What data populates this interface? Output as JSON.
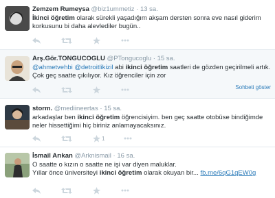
{
  "tweets": [
    {
      "name": "Zemzem Rumeysa",
      "handle": "@biz1ummetiz",
      "time": "13 sa.",
      "text_html": "<b>İkinci öğretim</b> olarak sürekli yaşadığım  akşam dersten sonra eve nasıl giderim korkusunu bi daha alevlediler bugün.."
    },
    {
      "name": "Arş.Gör.TONGUCOGLU",
      "handle": "@PTongucoglu",
      "time": "15 sa.",
      "text_html": "<span class=\"link\">@ahmetvehbi</span> <span class=\"link\">@detroitlikizil</span> abi <b>ikinci öğretim</b> saatleri de gözden geçirilmeli artık. Çok geç saatte çıkılıyor. Kız öğrenciler için zor",
      "show_conversation": "Sohbeti göster"
    },
    {
      "name": "storm.",
      "handle": "@mediineertas",
      "time": "15 sa.",
      "text_html": "arkadaşlar ben <b>ikinci öğretim</b> öğrencisiyim. ben geç saatte otobüse bindiğimde neler hissettiğimi hiç biriniz anlamayacaksınız.",
      "favorites": "1"
    },
    {
      "name": "İsmail Arıkan",
      "handle": "@Arknismail",
      "time": "16 sa.",
      "text_html": "O saatte o kızın o saatte ne işi var diyen maluklar.<br>Yıllar önce üniversiteyi <b>ikinci öğretim</b> olarak okuyan bir... <span class=\"link\" style=\"text-decoration:underline\">fb.me/6qG1qEW0g</span>"
    }
  ],
  "icons": {
    "reply": "reply-icon",
    "retweet": "retweet-icon",
    "favorite": "star-icon",
    "more": "more-icon"
  },
  "colors": {
    "link": "#2b7bb9",
    "muted": "#8899a6",
    "action": "#ccd6dd"
  }
}
